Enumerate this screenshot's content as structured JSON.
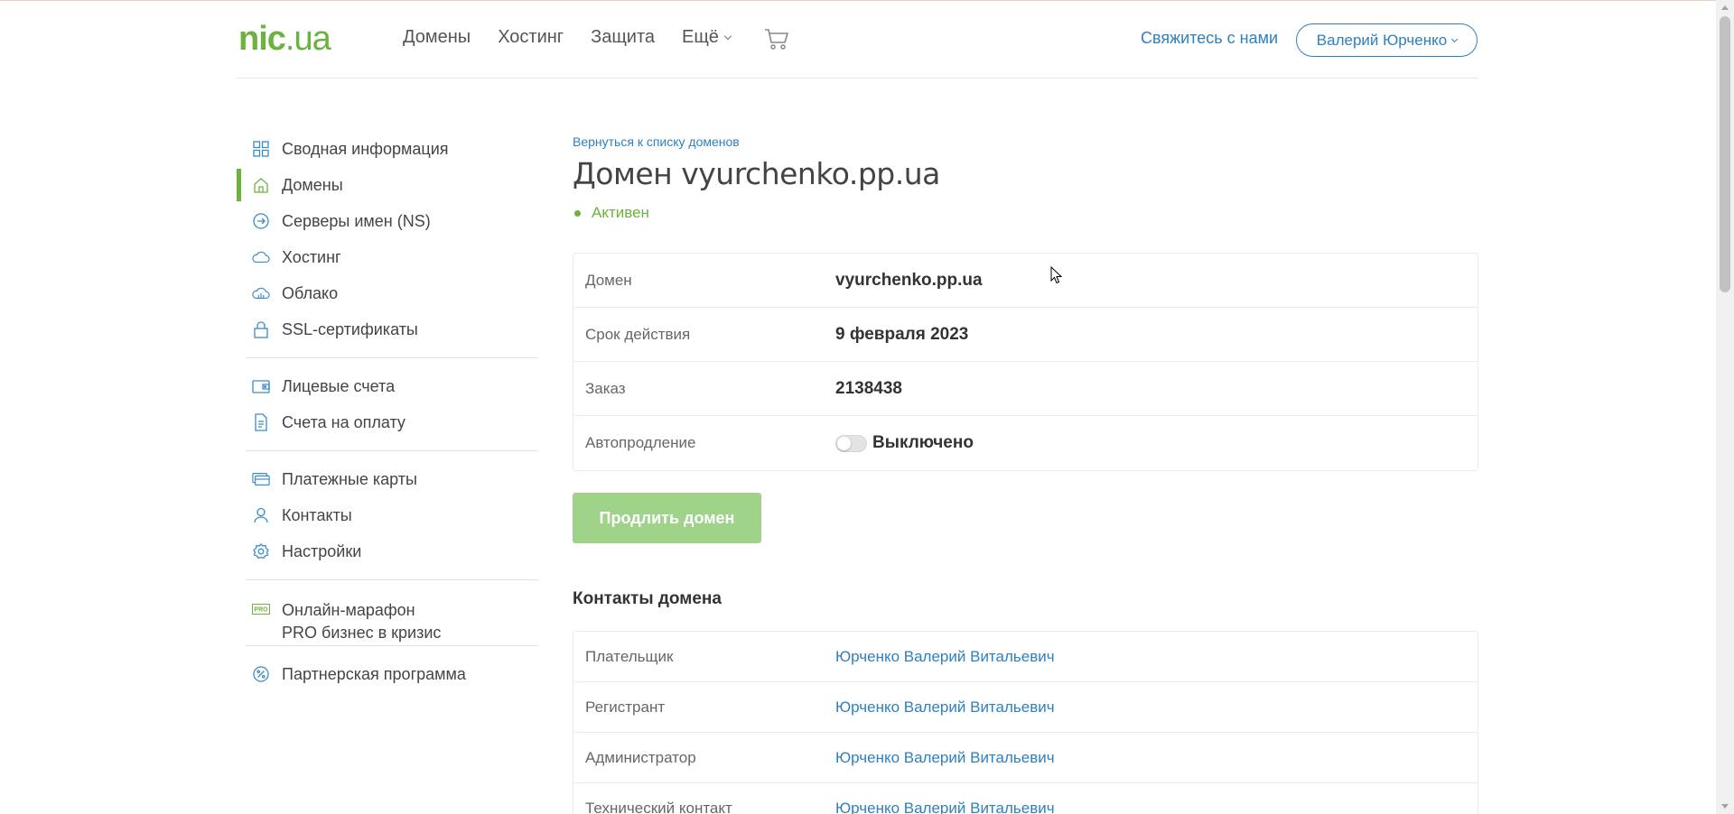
{
  "header": {
    "logo_main": "nic",
    "logo_suffix": ".ua",
    "nav": [
      {
        "label": "Домены"
      },
      {
        "label": "Хостинг"
      },
      {
        "label": "Защита"
      },
      {
        "label": "Ещё"
      }
    ],
    "contact_label": "Свяжитесь с нами",
    "user_name": "Валерий Юрченко"
  },
  "sidebar": {
    "items": [
      {
        "label": "Сводная информация",
        "icon": "dashboard-icon"
      },
      {
        "label": "Домены",
        "icon": "home-icon",
        "active": true
      },
      {
        "label": "Серверы имен (NS)",
        "icon": "arrow-circle-icon"
      },
      {
        "label": "Хостинг",
        "icon": "cloud-icon"
      },
      {
        "label": "Облако",
        "icon": "cloud-server-icon"
      },
      {
        "label": "SSL-сертификаты",
        "icon": "lock-icon"
      },
      {
        "label": "Лицевые счета",
        "icon": "wallet-icon"
      },
      {
        "label": "Счета на оплату",
        "icon": "document-icon"
      },
      {
        "label": "Платежные карты",
        "icon": "card-icon"
      },
      {
        "label": "Контакты",
        "icon": "user-icon"
      },
      {
        "label": "Настройки",
        "icon": "gear-icon"
      },
      {
        "label_line1": "Онлайн-марафон",
        "label_line2": "PRO бизнес в кризис",
        "icon": "pro-icon",
        "icon_text": "PRO"
      },
      {
        "label": "Партнерская программа",
        "icon": "percent-icon"
      }
    ]
  },
  "main": {
    "back_link": "Вернуться к списку доменов",
    "title": "Домен vyurchenko.pp.ua",
    "status": "Активен",
    "info": [
      {
        "key": "Домен",
        "value": "vyurchenko.pp.ua"
      },
      {
        "key": "Срок действия",
        "value": "9 февраля 2023"
      },
      {
        "key": "Заказ",
        "value": "2138438"
      },
      {
        "key": "Автопродление",
        "value": "Выключено"
      }
    ],
    "renew_button": "Продлить домен",
    "contacts_title": "Контакты домена",
    "contacts": [
      {
        "role": "Плательщик",
        "name": "Юрченко Валерий Витальевич"
      },
      {
        "role": "Регистрант",
        "name": "Юрченко Валерий Витальевич"
      },
      {
        "role": "Администратор",
        "name": "Юрченко Валерий Витальевич"
      },
      {
        "role": "Технический контакт",
        "name": "Юрченко Валерий Витальевич"
      }
    ]
  },
  "colors": {
    "brand_green": "#6cb33e",
    "link_blue": "#2e7fbf",
    "button_green_disabled": "#9fd389"
  }
}
